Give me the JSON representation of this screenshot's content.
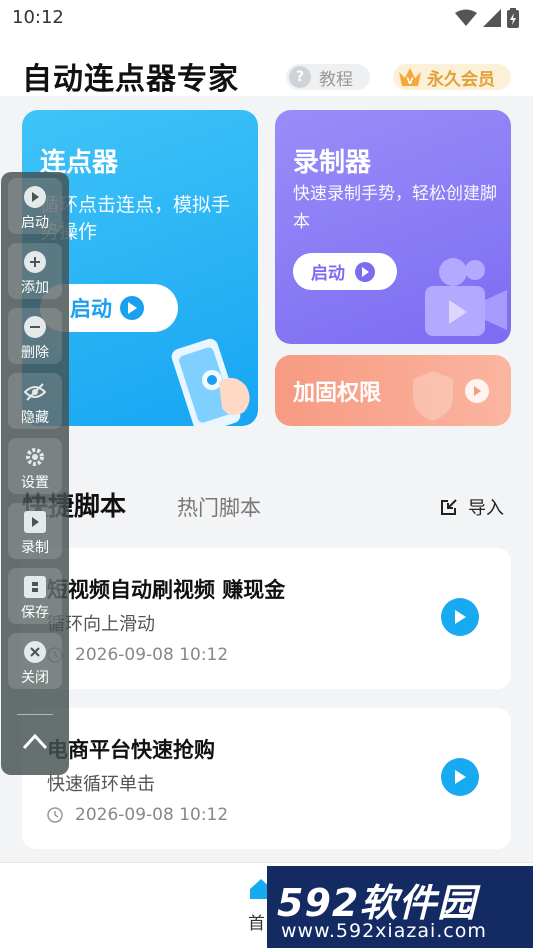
{
  "status_bar": {
    "time": "10:12"
  },
  "header": {
    "app_title": "自动连点器专家",
    "tutorial_label": "教程",
    "vip_label": "永久会员"
  },
  "cards": {
    "clicker": {
      "title": "连点器",
      "desc": "循环点击连点，模拟手势操作",
      "button_label": "启动"
    },
    "recorder": {
      "title": "录制器",
      "desc": "快速录制手势，轻松创建脚本",
      "button_label": "启动"
    },
    "permission": {
      "title": "加固权限"
    }
  },
  "section": {
    "tab_quick": "快捷脚本",
    "tab_hot": "热门脚本",
    "import_label": "导入"
  },
  "scripts": [
    {
      "name": "短视频自动刷视频 赚现金",
      "desc": "循环向上滑动",
      "date": "2026-09-08 10:12"
    },
    {
      "name": "电商平台快速抢购",
      "desc": "快速循环单击",
      "date": "2026-09-08 10:12"
    }
  ],
  "float_toolbar": {
    "items": [
      {
        "label": "启动",
        "icon": "play-icon"
      },
      {
        "label": "添加",
        "icon": "plus-icon"
      },
      {
        "label": "删除",
        "icon": "minus-icon"
      },
      {
        "label": "隐藏",
        "icon": "eye-off-icon"
      },
      {
        "label": "设置",
        "icon": "gear-icon"
      },
      {
        "label": "录制",
        "icon": "record-icon"
      },
      {
        "label": "保存",
        "icon": "save-icon"
      },
      {
        "label": "关闭",
        "icon": "close-icon"
      }
    ]
  },
  "bottom_nav": {
    "home_label": "首"
  },
  "watermark": {
    "brand": "592软件园",
    "url": "www.592xiazai.com"
  },
  "colors": {
    "clicker_blue": "#1aa0ee",
    "recorder_purple": "#7c6cf2",
    "permission_orange": "#f79a82",
    "vip_gold": "#e0a13a",
    "play_blue": "#18aaf0"
  }
}
